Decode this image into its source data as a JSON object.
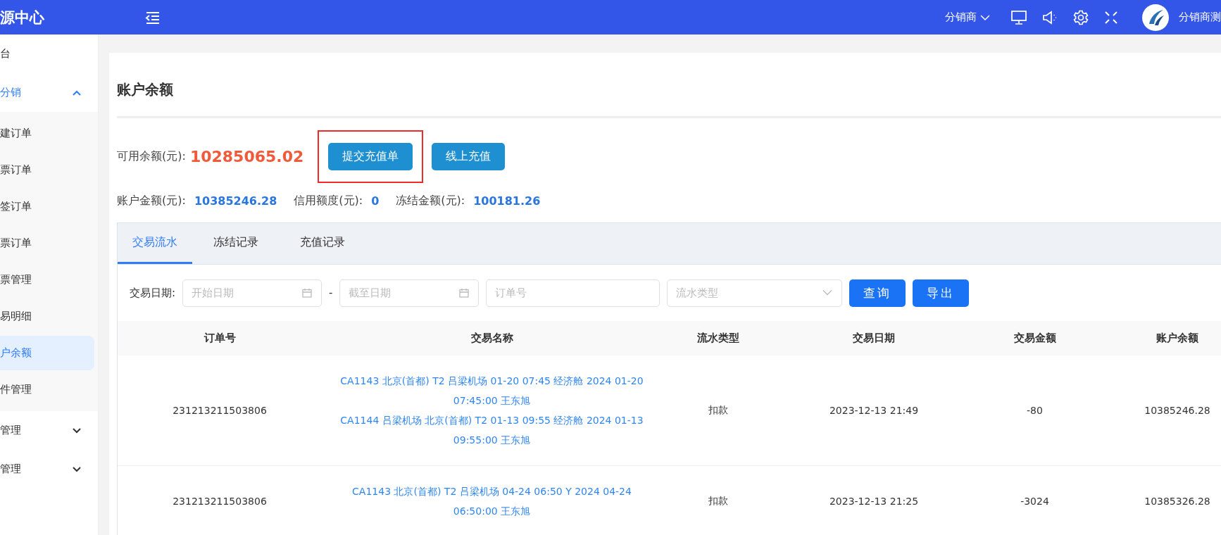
{
  "header": {
    "logo": "源中心",
    "distributor_menu": "分销商",
    "user_name": "分销商测"
  },
  "sidebar": {
    "items": [
      {
        "label": "台"
      },
      {
        "label": "分销",
        "expanded": true,
        "children": [
          {
            "label": "建订单",
            "selected": false
          },
          {
            "label": "票订单",
            "selected": false
          },
          {
            "label": "签订单",
            "selected": false
          },
          {
            "label": "票订单",
            "selected": false
          },
          {
            "label": "票管理",
            "selected": false
          },
          {
            "label": "易明细",
            "selected": false
          },
          {
            "label": "户余额",
            "selected": true
          },
          {
            "label": "件管理",
            "selected": false
          }
        ]
      },
      {
        "label": "管理",
        "expanded": false
      },
      {
        "label": "管理",
        "expanded": false
      }
    ]
  },
  "page": {
    "title": "账户余额",
    "available_label": "可用余额(元):",
    "available_value": "10285065.02",
    "buttons": [
      {
        "label": "提交充值单",
        "highlighted": true
      },
      {
        "label": "线上充值",
        "highlighted": false
      }
    ],
    "stats": [
      {
        "label": "账户金额(元):",
        "value": "10385246.28"
      },
      {
        "label": "信用额度(元):",
        "value": "0"
      },
      {
        "label": "冻结金额(元):",
        "value": "100181.26"
      }
    ]
  },
  "tabs": [
    {
      "label": "交易流水",
      "selected": true
    },
    {
      "label": "冻结记录",
      "selected": false
    },
    {
      "label": "充值记录",
      "selected": false
    }
  ],
  "filters": {
    "label": "交易日期:",
    "start_date": {
      "placeholder": "开始日期"
    },
    "separator": "-",
    "end_date": {
      "placeholder": "截至日期"
    },
    "order_no": {
      "placeholder": "订单号"
    },
    "flow_type": {
      "placeholder": "流水类型"
    },
    "buttons": [
      "查询",
      "导出"
    ]
  },
  "table": {
    "columns": [
      "订单号",
      "交易名称",
      "流水类型",
      "交易日期",
      "交易金额",
      "账户余额"
    ],
    "rows": [
      {
        "order_no": "231213211503806",
        "names": [
          "CA1143 北京(首都) T2 吕梁机场 01-20 07:45 经济舱 2024 01-20 07:45:00 王东旭",
          "CA1144 吕梁机场 北京(首都) T2 01-13 09:55 经济舱 2024 01-13 09:55:00 王东旭"
        ],
        "type": "扣款",
        "date": "2023-12-13 21:49",
        "amount": "-80",
        "balance": "10385246.28"
      },
      {
        "order_no": "231213211503806",
        "names": [
          "CA1143 北京(首都) T2 吕梁机场 04-24 06:50 Y 2024 04-24 06:50:00 王东旭"
        ],
        "type": "扣款",
        "date": "2023-12-13 21:25",
        "amount": "-3024",
        "balance": "10385326.28"
      }
    ]
  }
}
